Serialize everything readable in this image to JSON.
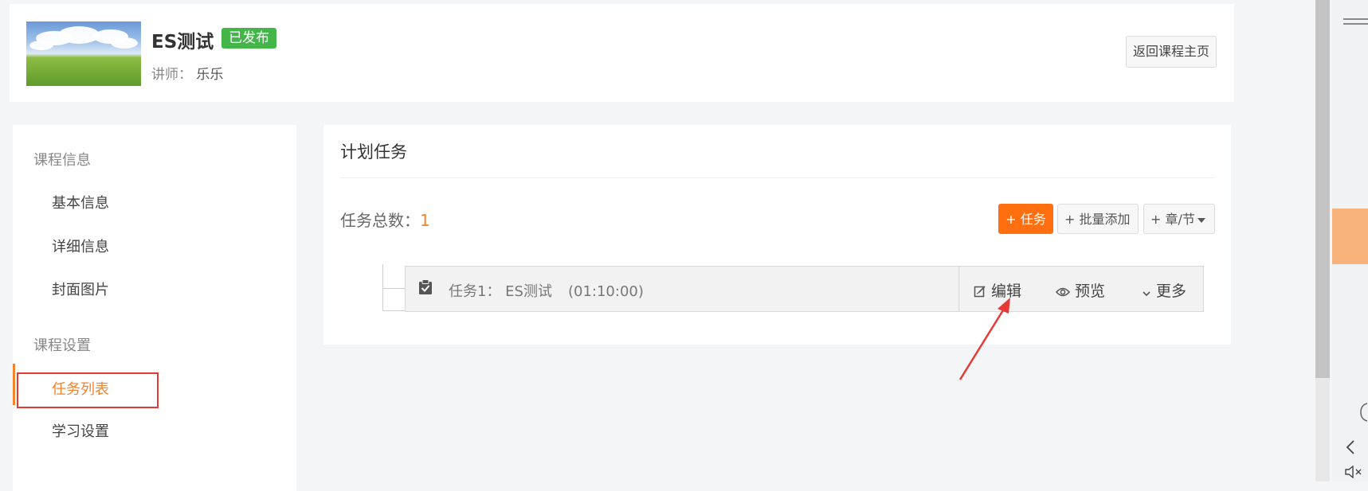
{
  "header": {
    "course_title": "ES测试",
    "status_badge": "已发布",
    "teacher_label": "讲师：",
    "teacher_name": "乐乐",
    "back_button": "返回课程主页"
  },
  "sidebar": {
    "sections": [
      {
        "title": "课程信息",
        "items": [
          "基本信息",
          "详细信息",
          "封面图片"
        ]
      },
      {
        "title": "课程设置",
        "items": [
          "任务列表",
          "学习设置"
        ]
      }
    ],
    "active_item": "任务列表"
  },
  "main": {
    "title": "计划任务",
    "task_count_label": "任务总数：",
    "task_count_value": "1",
    "buttons": {
      "add_task": "+ 任务",
      "batch_add": "+ 批量添加",
      "chapter": "+ 章/节"
    },
    "tasks": [
      {
        "label": "任务1：  ES测试",
        "duration": "(01:10:00)",
        "icon": "clipboard-check-icon",
        "actions": {
          "edit": "编辑",
          "preview": "预览",
          "more": "更多"
        }
      }
    ]
  },
  "colors": {
    "accent": "#ff6f0f",
    "active_text": "#f5832a",
    "published_badge": "#43b549",
    "annotation_red": "#e53935",
    "right_panel_highlight": "#f8b27c"
  },
  "icons": {
    "menu": "menu-icon",
    "back": "chevron-left-icon",
    "mute": "mute-icon",
    "cursor": "hand-icon"
  }
}
